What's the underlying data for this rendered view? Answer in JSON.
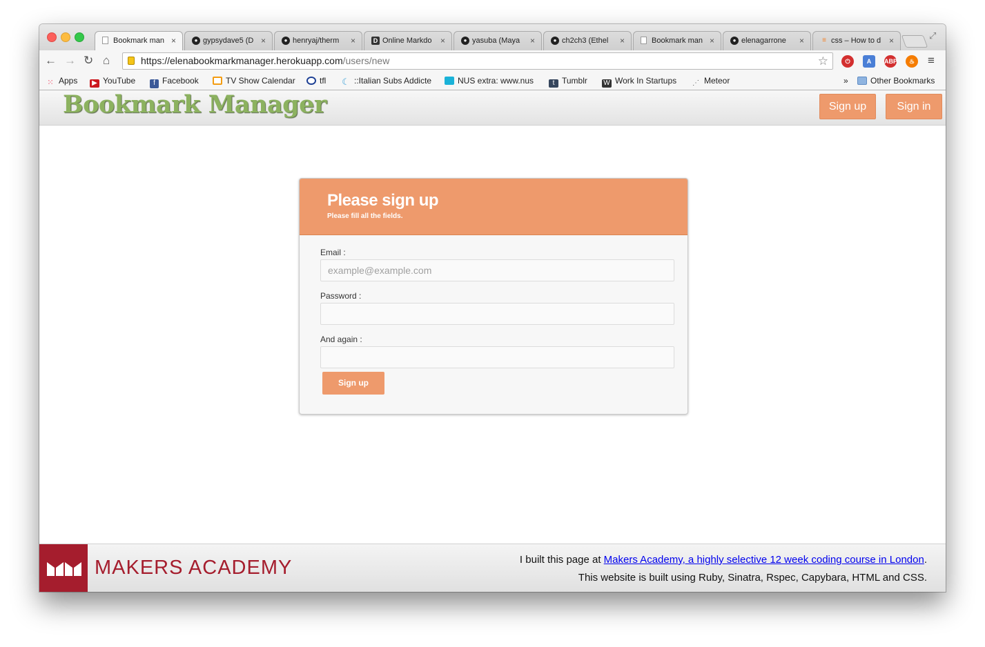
{
  "browser": {
    "tabs": [
      {
        "label": "Bookmark man",
        "icon": "page-icon",
        "active": true
      },
      {
        "label": "gypsydave5 (D",
        "icon": "github-icon"
      },
      {
        "label": "henryaj/therm",
        "icon": "github-icon"
      },
      {
        "label": "Online Markdo",
        "icon": "dillinger-icon"
      },
      {
        "label": "yasuba (Maya",
        "icon": "github-icon"
      },
      {
        "label": "ch2ch3 (Ethel",
        "icon": "github-icon"
      },
      {
        "label": "Bookmark man",
        "icon": "page-icon"
      },
      {
        "label": "elenagarrone",
        "icon": "github-icon"
      },
      {
        "label": "css – How to d",
        "icon": "stackoverflow-icon"
      }
    ],
    "url_host": "https://elenabookmarkmanager.herokuapp.com",
    "url_path": "/users/new",
    "bookmarks": [
      {
        "label": "Apps",
        "icon": "apps-grid-icon"
      },
      {
        "label": "YouTube",
        "icon": "youtube-icon"
      },
      {
        "label": "Facebook",
        "icon": "facebook-icon"
      },
      {
        "label": "TV Show Calendar",
        "icon": "tv-icon"
      },
      {
        "label": "tfl",
        "icon": "tfl-roundel-icon"
      },
      {
        "label": "::Italian Subs Addicte",
        "icon": "italian-subs-icon"
      },
      {
        "label": "NUS extra: www.nus",
        "icon": "nus-icon"
      },
      {
        "label": "Tumblr",
        "icon": "tumblr-icon"
      },
      {
        "label": "Work In Startups",
        "icon": "wis-icon"
      },
      {
        "label": "Meteor",
        "icon": "meteor-icon"
      }
    ],
    "bookmarks_overflow": "»",
    "other_bookmarks": "Other Bookmarks"
  },
  "site": {
    "logo": "Bookmark Manager",
    "signup_button": "Sign up",
    "signin_button": "Sign in"
  },
  "form": {
    "title": "Please sign up",
    "subtitle": "Please fill all the fields.",
    "email_label": "Email :",
    "email_placeholder": "example@example.com",
    "password_label": "Password :",
    "again_label": "And again :",
    "submit_label": "Sign up"
  },
  "footer": {
    "brand": "MAKERS ACADEMY",
    "line1_prefix": "I built this page at ",
    "line1_link": "Makers Academy, a highly selective 12 week coding course in London",
    "line1_suffix": ".",
    "line2": "This website is built using Ruby, Sinatra, Rspec, Capybara, HTML and CSS."
  },
  "colors": {
    "accent": "#ee9a6c",
    "logo_green": "#8cb25f",
    "makers_red": "#a51d2d"
  }
}
